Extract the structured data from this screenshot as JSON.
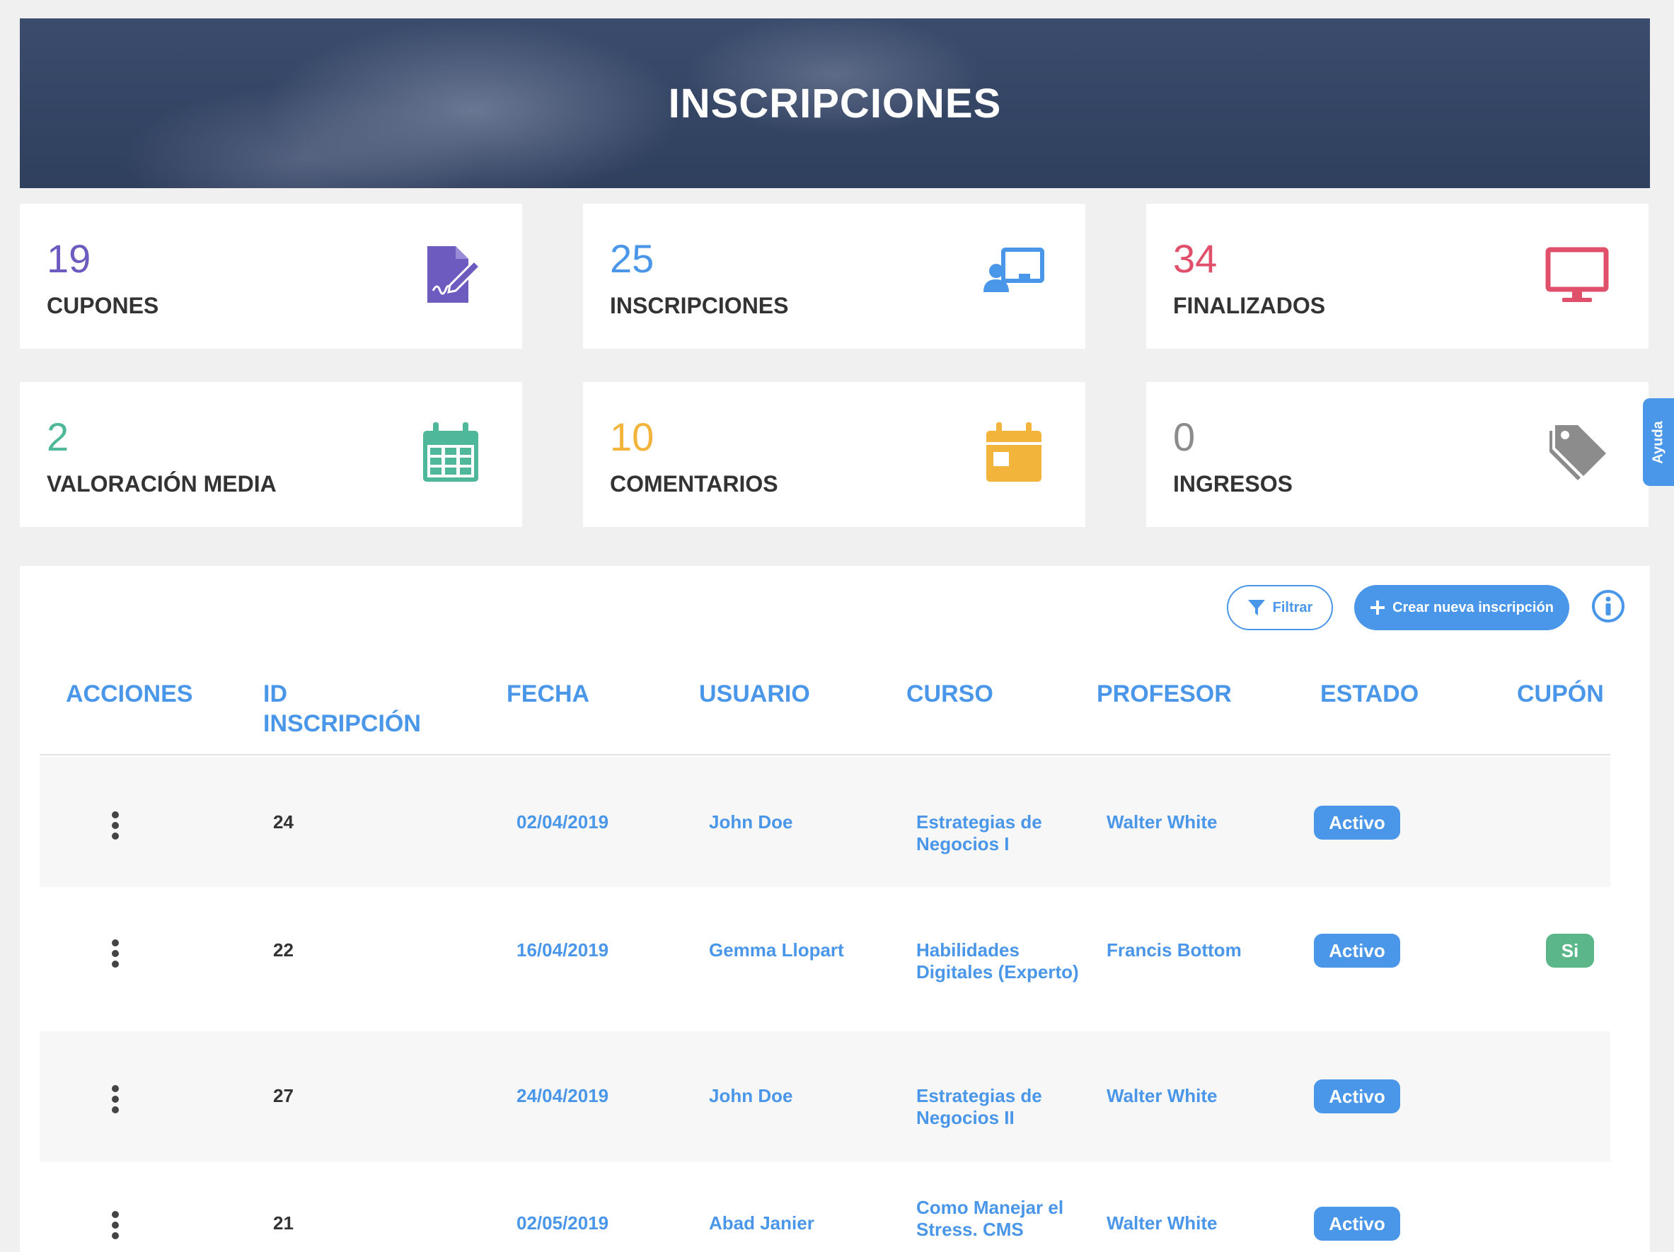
{
  "hero": {
    "title": "INSCRIPCIONES"
  },
  "stats": [
    {
      "value": "19",
      "label": "CUPONES",
      "color": "#6e5bbf",
      "icon": "signed-document-icon"
    },
    {
      "value": "25",
      "label": "INSCRIPCIONES",
      "color": "#4a96e8",
      "icon": "online-class-icon"
    },
    {
      "value": "34",
      "label": "FINALIZADOS",
      "color": "#e0506a",
      "icon": "monitor-icon"
    },
    {
      "value": "2",
      "label": "VALORACIÓN MEDIA",
      "color": "#4fb89a",
      "icon": "calendar-grid-icon"
    },
    {
      "value": "10",
      "label": "COMENTARIOS",
      "color": "#f3b43c",
      "icon": "calendar-icon"
    },
    {
      "value": "0",
      "label": "INGRESOS",
      "color": "#8c8c8c",
      "icon": "tags-icon"
    }
  ],
  "help_tab": "Ayuda",
  "toolbar": {
    "filter_label": "Filtrar",
    "create_label": "Crear nueva inscripción"
  },
  "table": {
    "headers": {
      "acciones": "ACCIONES",
      "id_line1": "ID",
      "id_line2": "INSCRIPCIÓN",
      "fecha": "FECHA",
      "usuario": "USUARIO",
      "curso": "CURSO",
      "profesor": "PROFESOR",
      "estado": "ESTADO",
      "cupon": "CUPÓN"
    },
    "rows": [
      {
        "id": "24",
        "fecha": "02/04/2019",
        "usuario": "John Doe",
        "curso_l1": "Estrategias de",
        "curso_l2": "Negocios I",
        "profesor": "Walter White",
        "estado": "Activo",
        "cupon": ""
      },
      {
        "id": "22",
        "fecha": "16/04/2019",
        "usuario": "Gemma Llopart",
        "curso_l1": "Habilidades",
        "curso_l2": "Digitales (Experto)",
        "profesor": "Francis Bottom",
        "estado": "Activo",
        "cupon": "Si"
      },
      {
        "id": "27",
        "fecha": "24/04/2019",
        "usuario": "John Doe",
        "curso_l1": "Estrategias de",
        "curso_l2": "Negocios II",
        "profesor": "Walter White",
        "estado": "Activo",
        "cupon": ""
      },
      {
        "id": "21",
        "fecha": "02/05/2019",
        "usuario": "Abad Janier",
        "curso_l1": "Como Manejar el",
        "curso_l2": "Stress. CMS",
        "profesor": "Walter White",
        "estado": "Activo",
        "cupon": ""
      }
    ]
  }
}
